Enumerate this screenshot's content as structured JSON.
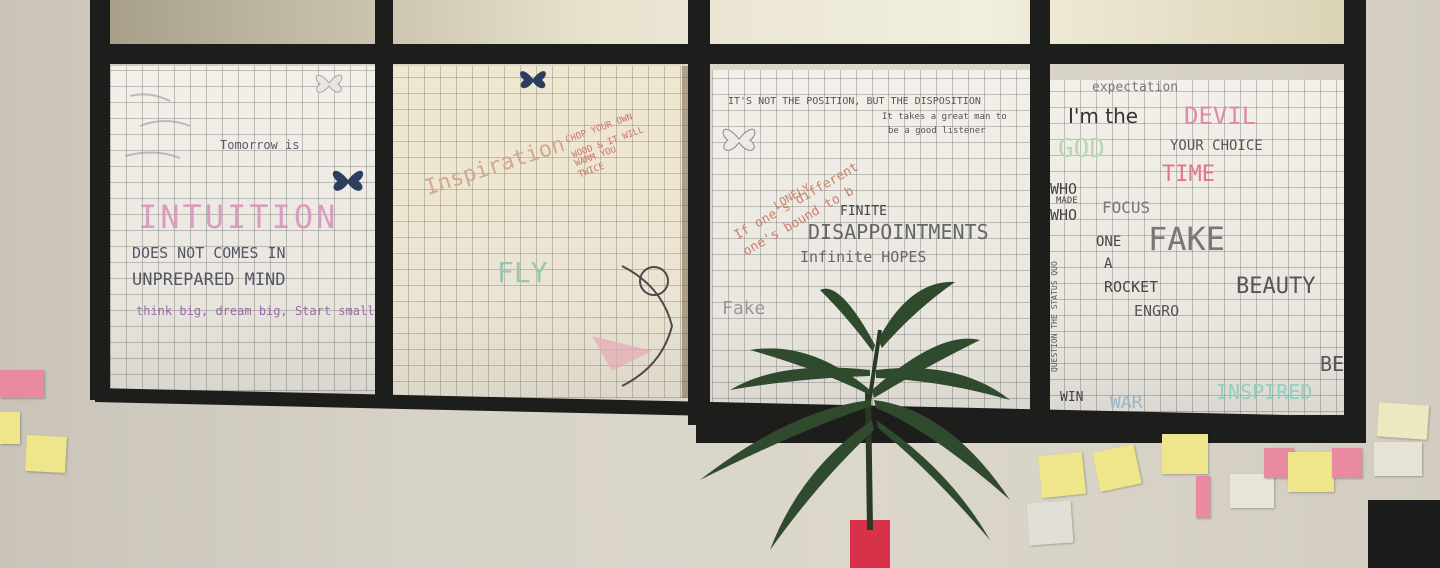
{
  "photo": {
    "pane1": {
      "lines": [
        "Tomorrow is",
        "INTUITION",
        "DOES NOT COMES IN",
        "UNPREPARED MIND",
        "think big, dream big, Start small"
      ]
    },
    "pane2": {
      "lines": [
        "Inspiration",
        "CHOP YOUR OWN",
        "WOOD & IT WILL",
        "WARM YOU",
        "TWICE",
        "FLY"
      ]
    },
    "pane3": {
      "lines": [
        "IT'S NOT THE POSITION, BUT THE DISPOSITION",
        "It takes a great man to",
        "be a good listener",
        "If one's different",
        "one's bound to b",
        "LONELY",
        "FINITE",
        "DISAPPOINTMENTS",
        "Infinite HOPES",
        "Fake"
      ]
    },
    "pane4": {
      "lines": [
        "expectation",
        "I'm the",
        "DEVIL",
        "GOD",
        "YOUR CHOICE",
        "TIME",
        "WHO",
        "MADE",
        "WHO",
        "FOCUS",
        "FAKE",
        "ONE",
        "A",
        "ROCKET",
        "BEAUTY",
        "ENGRO",
        "BE",
        "INSPIRED",
        "WIN",
        "WAR",
        "QUESTION THE STATUS QUO"
      ]
    },
    "colors": {
      "frame": "#1d1d1b",
      "wall": "#d8d3c8",
      "sticky_yellow": "#efe58a",
      "sticky_pink": "#e98aa0",
      "plant_leaf": "#2f4a2c"
    }
  }
}
